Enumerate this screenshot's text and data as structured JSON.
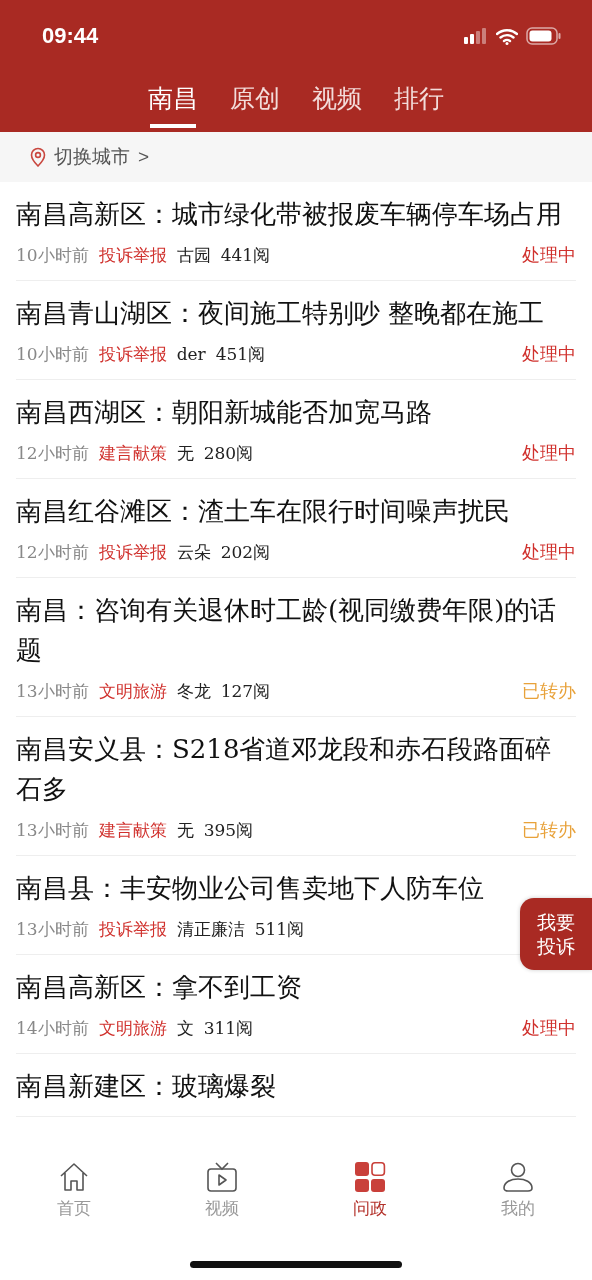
{
  "status_bar": {
    "time": "09:44"
  },
  "tabs": [
    {
      "label": "南昌",
      "selected": true
    },
    {
      "label": "原创",
      "selected": false
    },
    {
      "label": "视频",
      "selected": false
    },
    {
      "label": "排行",
      "selected": false
    }
  ],
  "city_switch": {
    "label": "切换城市",
    "arrow": ">"
  },
  "posts": [
    {
      "title": "南昌高新区：城市绿化带被报废车辆停车场占用",
      "time": "10小时前",
      "category": "投诉举报",
      "author": "古园",
      "reads": "441阅",
      "status": {
        "text": "处理中",
        "color": "#d0312d"
      }
    },
    {
      "title": "南昌青山湖区：夜间施工特别吵 整晚都在施工",
      "time": "10小时前",
      "category": "投诉举报",
      "author": "der",
      "reads": "451阅",
      "status": {
        "text": "处理中",
        "color": "#d0312d"
      }
    },
    {
      "title": "南昌西湖区：朝阳新城能否加宽马路",
      "time": "12小时前",
      "category": "建言献策",
      "author": "无",
      "reads": "280阅",
      "status": {
        "text": "处理中",
        "color": "#d0312d"
      }
    },
    {
      "title": "南昌红谷滩区：渣土车在限行时间噪声扰民",
      "time": "12小时前",
      "category": "投诉举报",
      "author": "云朵",
      "reads": "202阅",
      "status": {
        "text": "处理中",
        "color": "#d0312d"
      }
    },
    {
      "title": "南昌：咨询有关退休时工龄(视同缴费年限)的话题",
      "time": "13小时前",
      "category": "文明旅游",
      "author": "冬龙",
      "reads": "127阅",
      "status": {
        "text": "已转办",
        "color": "#e8a23a"
      }
    },
    {
      "title": "南昌安义县：S218省道邓龙段和赤石段路面碎石多",
      "time": "13小时前",
      "category": "建言献策",
      "author": "无",
      "reads": "395阅",
      "status": {
        "text": "已转办",
        "color": "#e8a23a"
      }
    },
    {
      "title": "南昌县：丰安物业公司售卖地下人防车位",
      "time": "13小时前",
      "category": "投诉举报",
      "author": "清正廉洁",
      "reads": "511阅"
    },
    {
      "title": "南昌高新区：拿不到工资",
      "time": "14小时前",
      "category": "文明旅游",
      "author": "文",
      "reads": "311阅",
      "status": {
        "text": "处理中",
        "color": "#d0312d"
      }
    },
    {
      "title": "南昌新建区：玻璃爆裂"
    }
  ],
  "float_button": {
    "label": "我要投诉"
  },
  "bottom_nav": [
    {
      "label": "首页",
      "selected": false
    },
    {
      "label": "视频",
      "selected": false
    },
    {
      "label": "问政",
      "selected": true
    },
    {
      "label": "我的",
      "selected": false
    }
  ]
}
